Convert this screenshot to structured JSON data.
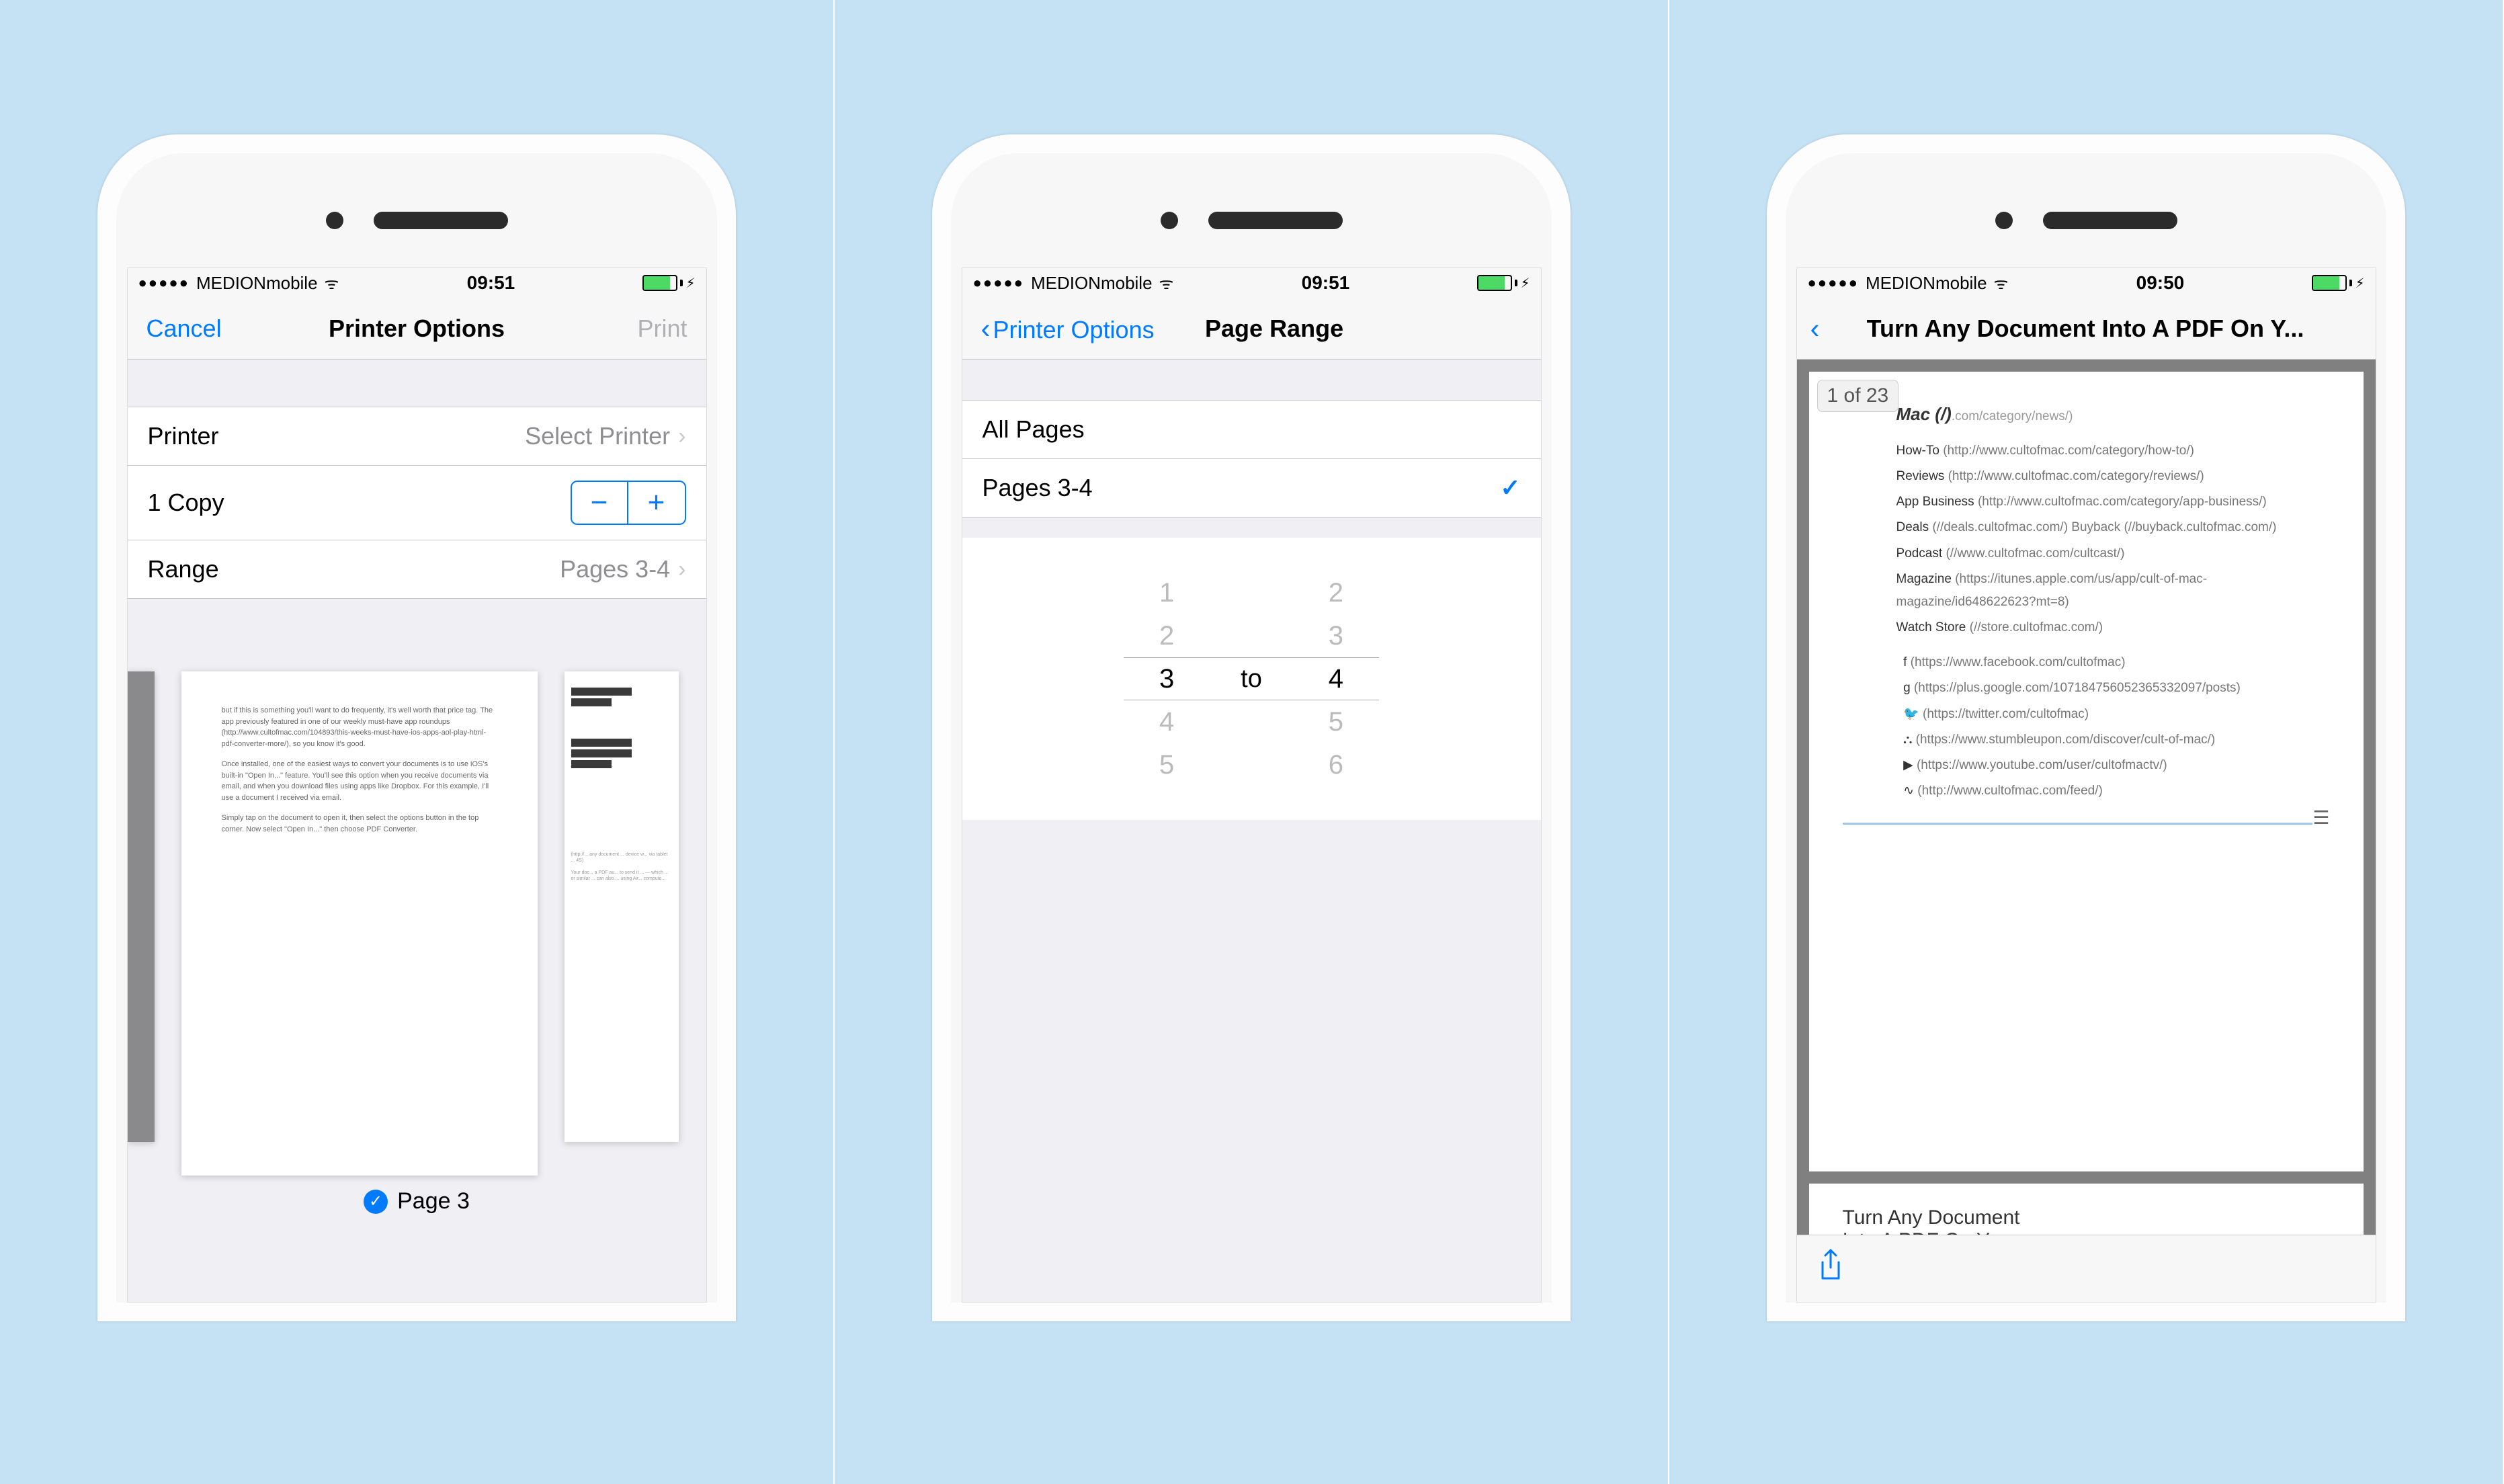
{
  "status": {
    "carrier": "MEDIONmobile",
    "time1": "09:51",
    "time2": "09:51",
    "time3": "09:50"
  },
  "screen1": {
    "cancel": "Cancel",
    "title": "Printer Options",
    "print": "Print",
    "printer_label": "Printer",
    "printer_value": "Select Printer",
    "copies_label": "1 Copy",
    "range_label": "Range",
    "range_value": "Pages 3-4",
    "page_indicator": "Page 3",
    "thumb_text": {
      "p1": "but if this is something you'll want to do frequently, it's well worth that price tag. The app previously featured in one of our weekly must-have app roundups (http://www.cultofmac.com/104893/this-weeks-must-have-ios-apps-aol-play-html-pdf-converter-more/), so you know it's good.",
      "p2": "Once installed, one of the easiest ways to convert your documents is to use iOS's built-in \"Open In...\" feature. You'll see this option when you receive documents via email, and when you download files using apps like Dropbox. For this example, I'll use a document I received via email.",
      "p3": "Simply tap on the document to open it, then select the options button in the top corner. Now select \"Open In...\" then choose PDF Converter."
    }
  },
  "screen2": {
    "back": "Printer Options",
    "title": "Page Range",
    "all_pages": "All Pages",
    "pages_selected": "Pages 3-4",
    "sep": "to",
    "picker": {
      "left": [
        "1",
        "2",
        "3",
        "4",
        "5"
      ],
      "right": [
        "2",
        "3",
        "4",
        "5",
        "6"
      ],
      "selected_left": "3",
      "selected_right": "4"
    }
  },
  "screen3": {
    "title": "Turn Any Document Into A PDF On Y...",
    "page_counter": "1 of 23",
    "header": "Mac (/)",
    "header_url": ".com/category/news/)",
    "links": [
      {
        "label": "How-To",
        "url": "(http://www.cultofmac.com/category/how-to/)"
      },
      {
        "label": "Reviews",
        "url": "(http://www.cultofmac.com/category/reviews/)"
      },
      {
        "label": "App Business",
        "url": "(http://www.cultofmac.com/category/app-business/)"
      },
      {
        "label": "Deals",
        "url": "(//deals.cultofmac.com/)   Buyback (//buyback.cultofmac.com/)"
      },
      {
        "label": "Podcast",
        "url": "(//www.cultofmac.com/cultcast/)"
      },
      {
        "label": "Magazine",
        "url": "(https://itunes.apple.com/us/app/cult-of-mac-magazine/id648622623?mt=8)"
      },
      {
        "label": "Watch Store",
        "url": "(//store.cultofmac.com/)"
      }
    ],
    "social": [
      "(https://www.facebook.com/cultofmac)",
      "(https://plus.google.com/107184756052365332097/posts)",
      "(https://twitter.com/cultofmac)",
      "(https://www.stumbleupon.com/discover/cult-of-mac/)",
      "(https://www.youtube.com/user/cultofmactv/)",
      "(http://www.cultofmac.com/feed/)"
    ],
    "second_page_title_l1": "Turn Any Document",
    "second_page_title_l2": "Into A PDF On Your"
  }
}
